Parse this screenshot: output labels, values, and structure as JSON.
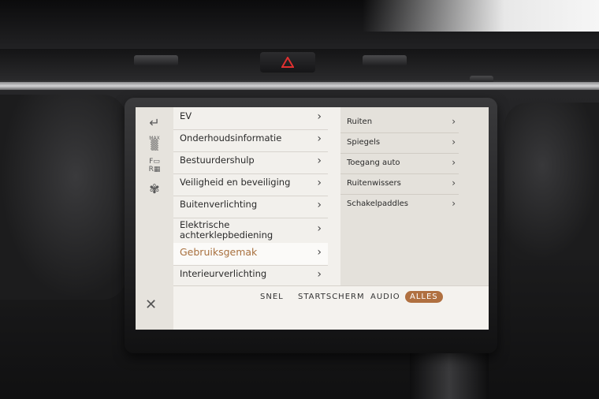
{
  "menu": {
    "items": [
      {
        "label": "EV"
      },
      {
        "label": "Onderhoudsinformatie"
      },
      {
        "label": "Bestuurdershulp"
      },
      {
        "label": "Veiligheid en beveiliging"
      },
      {
        "label": "Buitenverlichting"
      },
      {
        "label": "Elektrische achterklepbediening"
      },
      {
        "label": "Gebruiksgemak"
      },
      {
        "label": "Interieurverlichting"
      }
    ],
    "selected": "Gebruiksgemak"
  },
  "submenu": {
    "items": [
      {
        "label": "Ruiten"
      },
      {
        "label": "Spiegels"
      },
      {
        "label": "Toegang auto"
      },
      {
        "label": "Ruitenwissers"
      },
      {
        "label": "Schakelpaddles"
      }
    ]
  },
  "leftbar": {
    "max_label": "MAX",
    "f_label": "F",
    "r_label": "R"
  },
  "tabs": {
    "snel": "SNEL",
    "startscherm": "STARTSCHERM",
    "audio": "AUDIO",
    "alles": "ALLES",
    "active": "ALLES"
  },
  "colors": {
    "accent": "#b07040",
    "hazard": "#e03030"
  }
}
